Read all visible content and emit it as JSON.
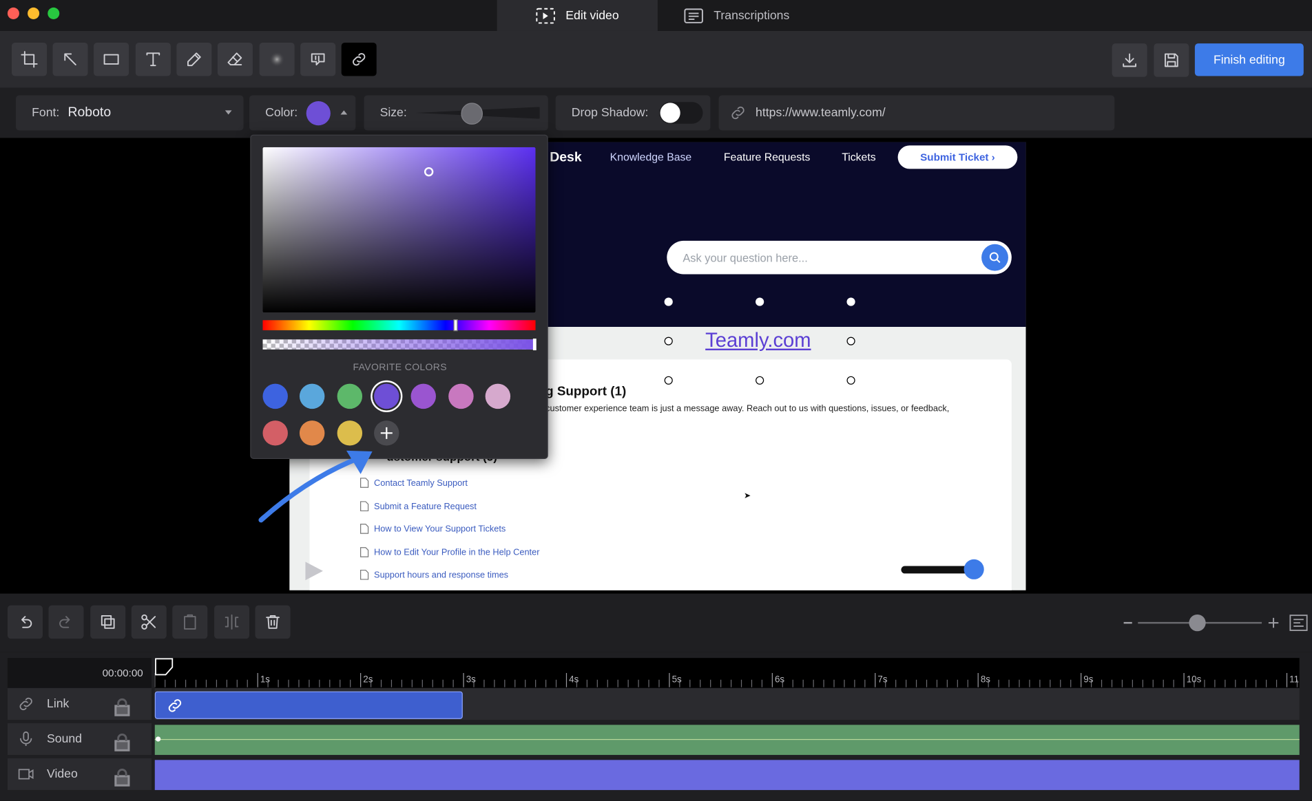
{
  "titlebar": {
    "tabs": [
      {
        "label": "Edit video",
        "icon": "edit-video-icon",
        "active": true
      },
      {
        "label": "Transcriptions",
        "icon": "transcriptions-icon",
        "active": false
      }
    ]
  },
  "toolbar": {
    "tools": [
      "crop-icon",
      "arrow-icon",
      "rectangle-icon",
      "text-icon",
      "pen-icon",
      "eraser-icon",
      "blur-icon",
      "callout-icon",
      "link-icon"
    ],
    "selected_tool": "link-icon",
    "finish_label": "Finish editing"
  },
  "properties": {
    "font_label": "Font:",
    "font_value": "Roboto",
    "color_label": "Color:",
    "color_value": "#6e4fd6",
    "size_label": "Size:",
    "size_value": 0.45,
    "shadow_label": "Drop Shadow:",
    "shadow_on": false,
    "url_value": "https://www.teamly.com/"
  },
  "picker": {
    "fav_label": "FAVORITE COLORS",
    "favorites": [
      "#3d63e0",
      "#5aa7dc",
      "#5db86a",
      "#6e4fd6",
      "#9a55d0",
      "#c878bf",
      "#d6a9cd",
      "#d35f66",
      "#e1884a",
      "#dcbd4c"
    ],
    "selected_favorite": 3
  },
  "screenshot": {
    "brand_fragment": "Desk",
    "nav": [
      "Knowledge Base",
      "Feature Requests",
      "Tickets"
    ],
    "submit_ticket": "Submit Ticket ›",
    "search_placeholder": "Ask your question here...",
    "link_text": "Teamly.com",
    "section_title": "g Support (1)",
    "section_desc": "customer experience team is just a message away. Reach out to us with questions, issues, or feedback,",
    "section2_fragment": "ustomer support (5)",
    "articles": [
      "Contact Teamly Support",
      "Submit a Feature Request",
      "How to View Your Support Tickets",
      "How to Edit Your Profile in the Help Center",
      "Support hours and response times"
    ]
  },
  "timeline": {
    "time": "00:00:00",
    "ticks": [
      "1s",
      "2s",
      "3s",
      "4s",
      "5s",
      "6s",
      "7s",
      "8s",
      "9s",
      "10s",
      "11"
    ],
    "tracks": [
      {
        "label": "Link",
        "icon": "link-icon"
      },
      {
        "label": "Sound",
        "icon": "microphone-icon"
      },
      {
        "label": "Video",
        "icon": "video-camera-icon"
      }
    ],
    "zoom_level": 0.48
  }
}
